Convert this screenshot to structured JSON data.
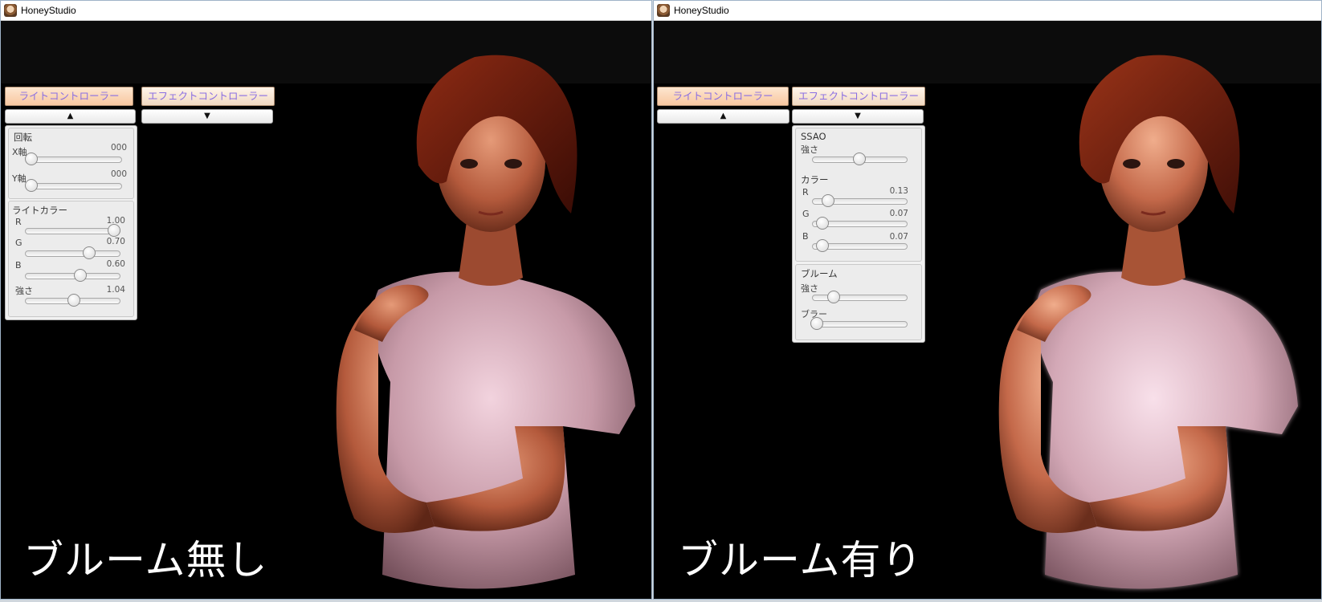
{
  "left_window": {
    "title": "HoneyStudio",
    "caption": "ブルーム無し",
    "tabs": {
      "light": "ライトコントローラー",
      "effect": "エフェクトコントローラー"
    },
    "light_arrow": "▲",
    "effect_arrow": "▼",
    "rotation": {
      "header": "回転",
      "x_label": "X軸",
      "x_value": "000",
      "x_level": 0.0,
      "y_label": "Y軸",
      "y_value": "000",
      "y_level": 0.0
    },
    "light_color": {
      "header": "ライトカラー",
      "r_label": "R",
      "r_value": "1.00",
      "r_level": 1.0,
      "g_label": "G",
      "g_value": "0.70",
      "g_level": 0.7,
      "b_label": "B",
      "b_value": "0.60",
      "b_level": 0.6,
      "strength_label": "強さ",
      "strength_value": "1.04",
      "strength_level": 0.52
    }
  },
  "right_window": {
    "title": "HoneyStudio",
    "caption": "ブルーム有り",
    "tabs": {
      "light": "ライトコントローラー",
      "effect": "エフェクトコントローラー"
    },
    "light_arrow": "▲",
    "effect_arrow": "▼",
    "ssao": {
      "header": "SSAO",
      "strength_label": "強さ",
      "strength_level": 0.5,
      "color_header": "カラー",
      "r_label": "R",
      "r_value": "0.13",
      "r_level": 0.13,
      "g_label": "G",
      "g_value": "0.07",
      "g_level": 0.07,
      "b_label": "B",
      "b_value": "0.07",
      "b_level": 0.07
    },
    "bloom": {
      "header": "ブルーム",
      "strength_label": "強さ",
      "strength_level": 0.2,
      "blur_label": "ブラー",
      "blur_level": 0.0
    }
  },
  "colors": {
    "tab_text": "#8a6ee2",
    "tab_bg": "#f8c7a0",
    "panel_bg": "#f1f1f1",
    "scene_bg": "#000000"
  }
}
